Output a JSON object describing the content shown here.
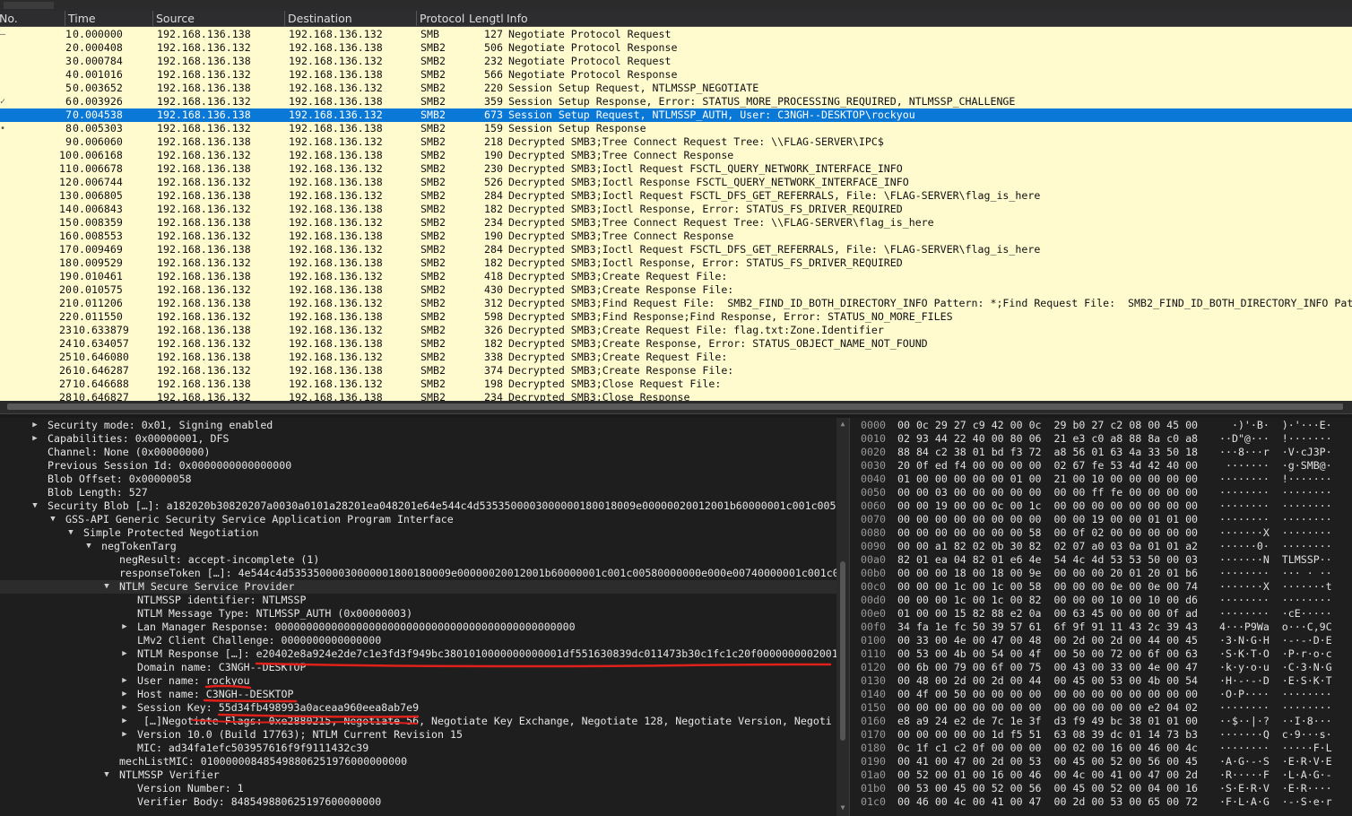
{
  "columns": [
    "No.",
    "Time",
    "Source",
    "Destination",
    "Protocol",
    "Lengtl",
    "Info"
  ],
  "packets": [
    {
      "no": "1",
      "time": "0.000000",
      "src": "192.168.136.138",
      "dst": "192.168.136.132",
      "proto": "SMB",
      "len": "127",
      "info": "Negotiate Protocol Request",
      "mark": "—"
    },
    {
      "no": "2",
      "time": "0.000408",
      "src": "192.168.136.132",
      "dst": "192.168.136.138",
      "proto": "SMB2",
      "len": "506",
      "info": "Negotiate Protocol Response"
    },
    {
      "no": "3",
      "time": "0.000784",
      "src": "192.168.136.138",
      "dst": "192.168.136.132",
      "proto": "SMB2",
      "len": "232",
      "info": "Negotiate Protocol Request"
    },
    {
      "no": "4",
      "time": "0.001016",
      "src": "192.168.136.132",
      "dst": "192.168.136.138",
      "proto": "SMB2",
      "len": "566",
      "info": "Negotiate Protocol Response"
    },
    {
      "no": "5",
      "time": "0.003652",
      "src": "192.168.136.138",
      "dst": "192.168.136.132",
      "proto": "SMB2",
      "len": "220",
      "info": "Session Setup Request, NTLMSSP_NEGOTIATE"
    },
    {
      "no": "6",
      "time": "0.003926",
      "src": "192.168.136.132",
      "dst": "192.168.136.138",
      "proto": "SMB2",
      "len": "359",
      "info": "Session Setup Response, Error: STATUS_MORE_PROCESSING_REQUIRED, NTLMSSP_CHALLENGE",
      "mark": "✓"
    },
    {
      "no": "7",
      "time": "0.004538",
      "src": "192.168.136.138",
      "dst": "192.168.136.132",
      "proto": "SMB2",
      "len": "673",
      "info": "Session Setup Request, NTLMSSP_AUTH, User: C3NGH--DESKTOP\\rockyou",
      "selected": true
    },
    {
      "no": "8",
      "time": "0.005303",
      "src": "192.168.136.132",
      "dst": "192.168.136.138",
      "proto": "SMB2",
      "len": "159",
      "info": "Session Setup Response",
      "mark": "•"
    },
    {
      "no": "9",
      "time": "0.006060",
      "src": "192.168.136.138",
      "dst": "192.168.136.132",
      "proto": "SMB2",
      "len": "218",
      "info": "Decrypted SMB3;Tree Connect Request Tree: \\\\FLAG-SERVER\\IPC$"
    },
    {
      "no": "10",
      "time": "0.006168",
      "src": "192.168.136.132",
      "dst": "192.168.136.138",
      "proto": "SMB2",
      "len": "190",
      "info": "Decrypted SMB3;Tree Connect Response"
    },
    {
      "no": "11",
      "time": "0.006678",
      "src": "192.168.136.138",
      "dst": "192.168.136.132",
      "proto": "SMB2",
      "len": "230",
      "info": "Decrypted SMB3;Ioctl Request FSCTL_QUERY_NETWORK_INTERFACE_INFO"
    },
    {
      "no": "12",
      "time": "0.006744",
      "src": "192.168.136.132",
      "dst": "192.168.136.138",
      "proto": "SMB2",
      "len": "526",
      "info": "Decrypted SMB3;Ioctl Response FSCTL_QUERY_NETWORK_INTERFACE_INFO"
    },
    {
      "no": "13",
      "time": "0.006805",
      "src": "192.168.136.138",
      "dst": "192.168.136.132",
      "proto": "SMB2",
      "len": "284",
      "info": "Decrypted SMB3;Ioctl Request FSCTL_DFS_GET_REFERRALS, File: \\FLAG-SERVER\\flag_is_here"
    },
    {
      "no": "14",
      "time": "0.006843",
      "src": "192.168.136.132",
      "dst": "192.168.136.138",
      "proto": "SMB2",
      "len": "182",
      "info": "Decrypted SMB3;Ioctl Response, Error: STATUS_FS_DRIVER_REQUIRED"
    },
    {
      "no": "15",
      "time": "0.008359",
      "src": "192.168.136.138",
      "dst": "192.168.136.132",
      "proto": "SMB2",
      "len": "234",
      "info": "Decrypted SMB3;Tree Connect Request Tree: \\\\FLAG-SERVER\\flag_is_here"
    },
    {
      "no": "16",
      "time": "0.008553",
      "src": "192.168.136.132",
      "dst": "192.168.136.138",
      "proto": "SMB2",
      "len": "190",
      "info": "Decrypted SMB3;Tree Connect Response"
    },
    {
      "no": "17",
      "time": "0.009469",
      "src": "192.168.136.138",
      "dst": "192.168.136.132",
      "proto": "SMB2",
      "len": "284",
      "info": "Decrypted SMB3;Ioctl Request FSCTL_DFS_GET_REFERRALS, File: \\FLAG-SERVER\\flag_is_here"
    },
    {
      "no": "18",
      "time": "0.009529",
      "src": "192.168.136.132",
      "dst": "192.168.136.138",
      "proto": "SMB2",
      "len": "182",
      "info": "Decrypted SMB3;Ioctl Response, Error: STATUS_FS_DRIVER_REQUIRED"
    },
    {
      "no": "19",
      "time": "0.010461",
      "src": "192.168.136.138",
      "dst": "192.168.136.132",
      "proto": "SMB2",
      "len": "418",
      "info": "Decrypted SMB3;Create Request File:"
    },
    {
      "no": "20",
      "time": "0.010575",
      "src": "192.168.136.132",
      "dst": "192.168.136.138",
      "proto": "SMB2",
      "len": "430",
      "info": "Decrypted SMB3;Create Response File:"
    },
    {
      "no": "21",
      "time": "0.011206",
      "src": "192.168.136.138",
      "dst": "192.168.136.132",
      "proto": "SMB2",
      "len": "312",
      "info": "Decrypted SMB3;Find Request File:  SMB2_FIND_ID_BOTH_DIRECTORY_INFO Pattern: *;Find Request File:  SMB2_FIND_ID_BOTH_DIRECTORY_INFO Pat"
    },
    {
      "no": "22",
      "time": "0.011550",
      "src": "192.168.136.132",
      "dst": "192.168.136.138",
      "proto": "SMB2",
      "len": "598",
      "info": "Decrypted SMB3;Find Response;Find Response, Error: STATUS_NO_MORE_FILES"
    },
    {
      "no": "23",
      "time": "10.633879",
      "src": "192.168.136.138",
      "dst": "192.168.136.132",
      "proto": "SMB2",
      "len": "326",
      "info": "Decrypted SMB3;Create Request File: flag.txt:Zone.Identifier"
    },
    {
      "no": "24",
      "time": "10.634057",
      "src": "192.168.136.132",
      "dst": "192.168.136.138",
      "proto": "SMB2",
      "len": "182",
      "info": "Decrypted SMB3;Create Response, Error: STATUS_OBJECT_NAME_NOT_FOUND"
    },
    {
      "no": "25",
      "time": "10.646080",
      "src": "192.168.136.138",
      "dst": "192.168.136.132",
      "proto": "SMB2",
      "len": "338",
      "info": "Decrypted SMB3;Create Request File:"
    },
    {
      "no": "26",
      "time": "10.646287",
      "src": "192.168.136.132",
      "dst": "192.168.136.138",
      "proto": "SMB2",
      "len": "374",
      "info": "Decrypted SMB3;Create Response File:"
    },
    {
      "no": "27",
      "time": "10.646688",
      "src": "192.168.136.138",
      "dst": "192.168.136.132",
      "proto": "SMB2",
      "len": "198",
      "info": "Decrypted SMB3;Close Request File:"
    },
    {
      "no": "28",
      "time": "10.646827",
      "src": "192.168.136.132",
      "dst": "192.168.136.138",
      "proto": "SMB2",
      "len": "234",
      "info": "Decrypted SMB3;Close Response"
    }
  ],
  "details": [
    {
      "indent": 1,
      "tw": "▶",
      "text": "Security mode: 0x01, Signing enabled"
    },
    {
      "indent": 1,
      "tw": "▶",
      "text": "Capabilities: 0x00000001, DFS"
    },
    {
      "indent": 1,
      "tw": "",
      "text": "Channel: None (0x00000000)"
    },
    {
      "indent": 1,
      "tw": "",
      "text": "Previous Session Id: 0x0000000000000000"
    },
    {
      "indent": 1,
      "tw": "",
      "text": "Blob Offset: 0x00000058"
    },
    {
      "indent": 1,
      "tw": "",
      "text": "Blob Length: 527"
    },
    {
      "indent": 1,
      "tw": "▼",
      "text": "Security Blob […]: a182020b30820207a0030a0101a28201ea048201e64e544c4d5353500003000000180018009e00000020012001b60000001c001c005"
    },
    {
      "indent": 2,
      "tw": "▼",
      "text": "GSS-API Generic Security Service Application Program Interface"
    },
    {
      "indent": 3,
      "tw": "▼",
      "text": "Simple Protected Negotiation"
    },
    {
      "indent": 4,
      "tw": "▼",
      "text": "negTokenTarg"
    },
    {
      "indent": 5,
      "tw": "",
      "text": "negResult: accept-incomplete (1)"
    },
    {
      "indent": 5,
      "tw": "",
      "text": "responseToken […]: 4e544c4d53535000030000001800180009e00000020012001b60000001c001c00580000000e000e00740000001c001c0"
    },
    {
      "indent": 5,
      "tw": "▼",
      "text": "NTLM Secure Service Provider",
      "hl": true
    },
    {
      "indent": 6,
      "tw": "",
      "text": "NTLMSSP identifier: NTLMSSP"
    },
    {
      "indent": 6,
      "tw": "",
      "text": "NTLM Message Type: NTLMSSP_AUTH (0x00000003)"
    },
    {
      "indent": 6,
      "tw": "▶",
      "text": "Lan Manager Response: 000000000000000000000000000000000000000000000000"
    },
    {
      "indent": 6,
      "tw": "",
      "text": "LMv2 Client Challenge: 0000000000000000"
    },
    {
      "indent": 6,
      "tw": "▶",
      "text": "NTLM Response […]: e20402e8a924e2de7c1e3fd3f949bc3801010000000000001df551630839dc011473b30c1fc1c20f0000000002001"
    },
    {
      "indent": 6,
      "tw": "",
      "text": "Domain name: C3NGH--DESKTOP"
    },
    {
      "indent": 6,
      "tw": "▶",
      "text": "User name: rockyou"
    },
    {
      "indent": 6,
      "tw": "▶",
      "text": "Host name: C3NGH--DESKTOP"
    },
    {
      "indent": 6,
      "tw": "▶",
      "text": "Session Key: 55d34fb498993a0aceaa960eea8ab7e9"
    },
    {
      "indent": 6,
      "tw": "▶",
      "text": " […]Negotiate Flags: 0xe2880215, Negotiate 56, Negotiate Key Exchange, Negotiate 128, Negotiate Version, Negoti"
    },
    {
      "indent": 6,
      "tw": "▶",
      "text": "Version 10.0 (Build 17763); NTLM Current Revision 15"
    },
    {
      "indent": 6,
      "tw": "",
      "text": "MIC: ad34fa1efc503957616f9f9111432c39"
    },
    {
      "indent": 5,
      "tw": "",
      "text": "mechListMIC: 010000008485498806251976000000000"
    },
    {
      "indent": 5,
      "tw": "▼",
      "text": "NTLMSSP Verifier"
    },
    {
      "indent": 6,
      "tw": "",
      "text": "Version Number: 1"
    },
    {
      "indent": 6,
      "tw": "",
      "text": "Verifier Body: 848549880625197600000000"
    }
  ],
  "hex": [
    {
      "off": "0000",
      "hex": "00 0c 29 27 c9 42 00 0c  29 b0 27 c2 08 00 45 00",
      "ascii": "  ·)'·B·  )·'···E·"
    },
    {
      "off": "0010",
      "hex": "02 93 44 22 40 00 80 06  21 e3 c0 a8 88 8a c0 a8",
      "ascii": "··D\"@···  !·······"
    },
    {
      "off": "0020",
      "hex": "88 84 c2 38 01 bd f3 72  a8 56 01 63 4a 33 50 18",
      "ascii": "···8···r  ·V·cJ3P·"
    },
    {
      "off": "0030",
      "hex": "20 0f ed f4 00 00 00 00  02 67 fe 53 4d 42 40 00",
      "ascii": " ·······  ·g·SMB@·"
    },
    {
      "off": "0040",
      "hex": "01 00 00 00 00 00 01 00  21 00 10 00 00 00 00 00",
      "ascii": "········  !·······"
    },
    {
      "off": "0050",
      "hex": "00 00 03 00 00 00 00 00  00 00 ff fe 00 00 00 00",
      "ascii": "········  ········"
    },
    {
      "off": "0060",
      "hex": "00 00 19 00 00 0c 00 1c  00 00 00 00 00 00 00 00",
      "ascii": "········  ········"
    },
    {
      "off": "0070",
      "hex": "00 00 00 00 00 00 00 00  00 00 19 00 00 01 01 00",
      "ascii": "········  ········"
    },
    {
      "off": "0080",
      "hex": "00 00 00 00 00 00 00 58  00 0f 02 00 00 00 00 00",
      "ascii": "·······X  ········"
    },
    {
      "off": "0090",
      "hex": "00 00 a1 82 02 0b 30 82  02 07 a0 03 0a 01 01 a2",
      "ascii": "······0·  ········"
    },
    {
      "off": "00a0",
      "hex": "82 01 ea 04 82 01 e6 4e  54 4c 4d 53 53 50 00 03",
      "ascii": "·······N  TLMSSP··"
    },
    {
      "off": "00b0",
      "hex": "00 00 00 18 00 18 00 9e  00 00 00 20 01 20 01 b6",
      "ascii": "········  ··· · ··"
    },
    {
      "off": "00c0",
      "hex": "00 00 00 1c 00 1c 00 58  00 00 00 0e 00 0e 00 74",
      "ascii": "·······X  ·······t"
    },
    {
      "off": "00d0",
      "hex": "00 00 00 1c 00 1c 00 82  00 00 00 10 00 10 00 d6",
      "ascii": "········  ········"
    },
    {
      "off": "00e0",
      "hex": "01 00 00 15 82 88 e2 0a  00 63 45 00 00 00 0f ad",
      "ascii": "········  ·cE·····"
    },
    {
      "off": "00f0",
      "hex": "34 fa 1e fc 50 39 57 61  6f 9f 91 11 43 2c 39 43",
      "ascii": "4···P9Wa  o···C,9C"
    },
    {
      "off": "0100",
      "hex": "00 33 00 4e 00 47 00 48  00 2d 00 2d 00 44 00 45",
      "ascii": "·3·N·G·H  ·-·-·D·E"
    },
    {
      "off": "0110",
      "hex": "00 53 00 4b 00 54 00 4f  00 50 00 72 00 6f 00 63",
      "ascii": "·S·K·T·O  ·P·r·o·c"
    },
    {
      "off": "0120",
      "hex": "00 6b 00 79 00 6f 00 75  00 43 00 33 00 4e 00 47",
      "ascii": "·k·y·o·u  ·C·3·N·G"
    },
    {
      "off": "0130",
      "hex": "00 48 00 2d 00 2d 00 44  00 45 00 53 00 4b 00 54",
      "ascii": "·H·-·-·D  ·E·S·K·T"
    },
    {
      "off": "0140",
      "hex": "00 4f 00 50 00 00 00 00  00 00 00 00 00 00 00 00",
      "ascii": "·O·P····  ········"
    },
    {
      "off": "0150",
      "hex": "00 00 00 00 00 00 00 00  00 00 00 00 00 e2 04 02",
      "ascii": "········  ········"
    },
    {
      "off": "0160",
      "hex": "e8 a9 24 e2 de 7c 1e 3f  d3 f9 49 bc 38 01 01 00",
      "ascii": "··$··|·?  ··I·8···"
    },
    {
      "off": "0170",
      "hex": "00 00 00 00 00 1d f5 51  63 08 39 dc 01 14 73 b3",
      "ascii": "·······Q  c·9···s·"
    },
    {
      "off": "0180",
      "hex": "0c 1f c1 c2 0f 00 00 00  00 02 00 16 00 46 00 4c",
      "ascii": "········  ·····F·L"
    },
    {
      "off": "0190",
      "hex": "00 41 00 47 00 2d 00 53  00 45 00 52 00 56 00 45",
      "ascii": "·A·G·-·S  ·E·R·V·E"
    },
    {
      "off": "01a0",
      "hex": "00 52 00 01 00 16 00 46  00 4c 00 41 00 47 00 2d",
      "ascii": "·R·····F  ·L·A·G·-"
    },
    {
      "off": "01b0",
      "hex": "00 53 00 45 00 52 00 56  00 45 00 52 00 04 00 16",
      "ascii": "·S·E·R·V  ·E·R····"
    },
    {
      "off": "01c0",
      "hex": "00 46 00 4c 00 41 00 47  00 2d 00 53 00 65 00 72",
      "ascii": "·F·L·A·G  ·-·S·e·r"
    }
  ],
  "colors": {
    "list_bg": "#fffbcf",
    "selected_row": "#0a78d7",
    "annotation": "#e0211b",
    "pane_bg": "#1e1e1e"
  }
}
